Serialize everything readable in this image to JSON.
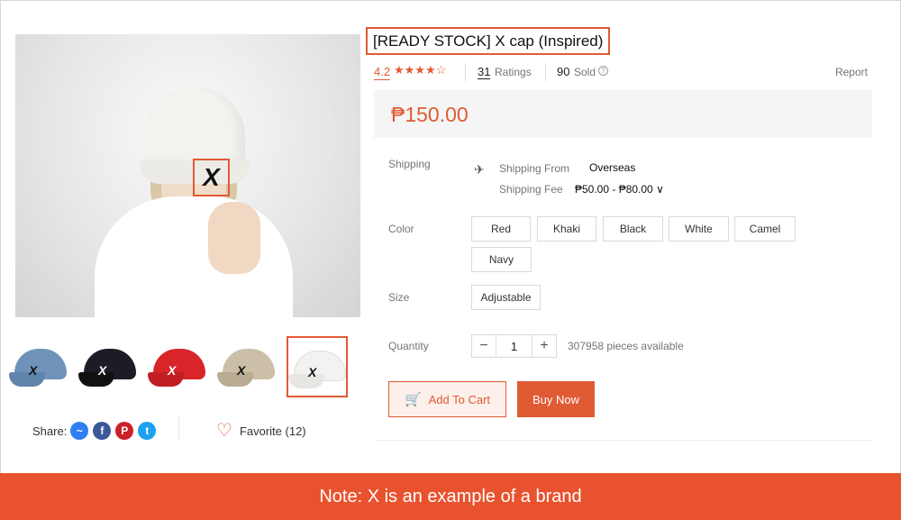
{
  "product": {
    "title": "[READY STOCK] X cap (Inspired)",
    "image_logo_mark": "X",
    "rating": "4.2",
    "stars": "★★★★☆",
    "ratings_count": "31",
    "ratings_label": "Ratings",
    "sold_count": "90",
    "sold_label": "Sold",
    "report_label": "Report",
    "price": "₱150.00"
  },
  "shipping": {
    "label": "Shipping",
    "from_label": "Shipping From",
    "from_value": "Overseas",
    "fee_label": "Shipping Fee",
    "fee_value": "₱50.00 - ₱80.00 ∨"
  },
  "color": {
    "label": "Color",
    "options": [
      "Red",
      "Khaki",
      "Black",
      "White",
      "Camel",
      "Navy"
    ]
  },
  "size": {
    "label": "Size",
    "options": [
      "Adjustable"
    ]
  },
  "quantity": {
    "label": "Quantity",
    "minus": "−",
    "value": "1",
    "plus": "+",
    "available": "307958 pieces available"
  },
  "actions": {
    "add_to_cart": "Add To Cart",
    "buy_now": "Buy Now"
  },
  "thumbnails": [
    {
      "color": "#6f93b8",
      "mark_color": "#111"
    },
    {
      "color": "#1c1c24",
      "mark_color": "#fff"
    },
    {
      "color": "#d8252a",
      "mark_color": "#fff"
    },
    {
      "color": "#cbbfa8",
      "mark_color": "#111"
    },
    {
      "color": "#f2f2f0",
      "mark_color": "#111"
    }
  ],
  "share": {
    "label": "Share:",
    "icons": [
      {
        "name": "messenger-icon",
        "glyph": "~",
        "color": "#2f7ff2"
      },
      {
        "name": "facebook-icon",
        "glyph": "f",
        "color": "#3b5998"
      },
      {
        "name": "pinterest-icon",
        "glyph": "P",
        "color": "#cb2027"
      },
      {
        "name": "twitter-icon",
        "glyph": "t",
        "color": "#1da1f2"
      }
    ]
  },
  "favorite": {
    "label": "Favorite (12)"
  },
  "note": "Note: X is an example of a brand",
  "colors": {
    "accent": "#e05a34",
    "note_bar": "#e8522e"
  }
}
